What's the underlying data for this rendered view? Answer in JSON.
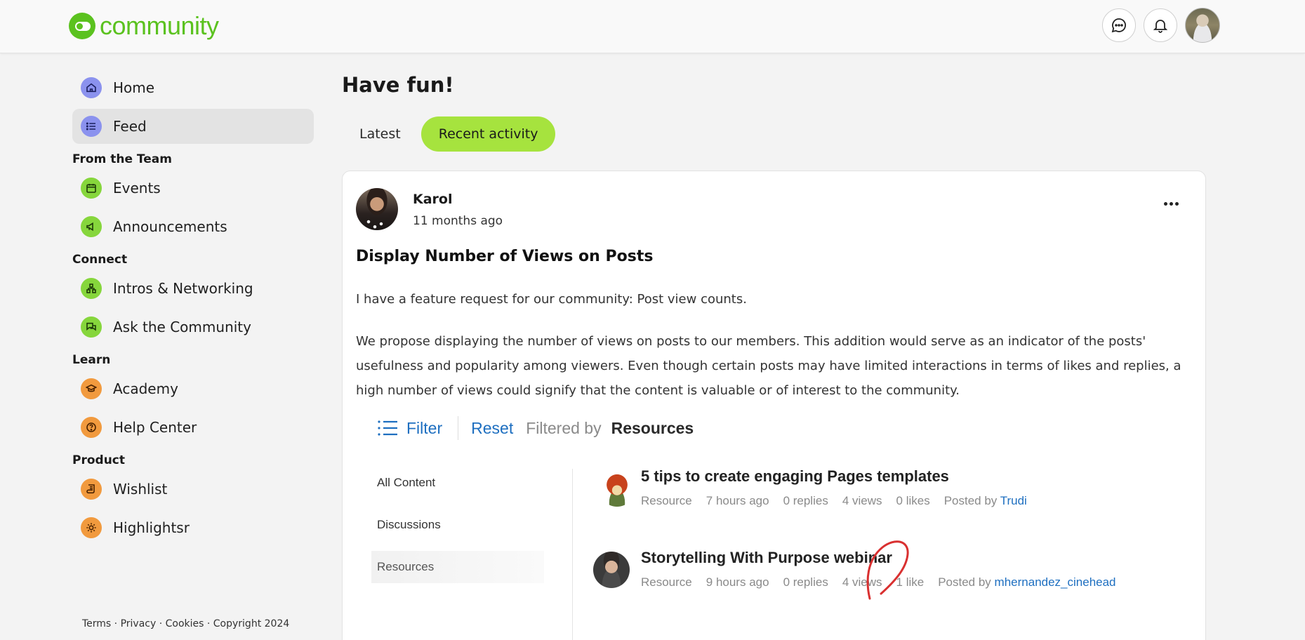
{
  "header": {
    "brand": "community",
    "icons": [
      "chat-bubble-icon",
      "bell-icon"
    ]
  },
  "sidebar": {
    "top_items": [
      {
        "label": "Home",
        "icon": "home-icon",
        "color": "#8b92ee"
      },
      {
        "label": "Feed",
        "icon": "list-icon",
        "color": "#8b92ee",
        "active": true
      }
    ],
    "sections": [
      {
        "title": "From the Team",
        "items": [
          {
            "label": "Events",
            "icon": "calendar-icon",
            "color": "#86d63c"
          },
          {
            "label": "Announcements",
            "icon": "megaphone-icon",
            "color": "#86d63c"
          }
        ]
      },
      {
        "title": "Connect",
        "items": [
          {
            "label": "Intros & Networking",
            "icon": "network-icon",
            "color": "#86d63c"
          },
          {
            "label": "Ask the Community",
            "icon": "chat-icon",
            "color": "#86d63c"
          }
        ]
      },
      {
        "title": "Learn",
        "items": [
          {
            "label": "Academy",
            "icon": "graduation-cap-icon",
            "color": "#f19a3e"
          },
          {
            "label": "Help Center",
            "icon": "question-icon",
            "color": "#f19a3e"
          }
        ]
      },
      {
        "title": "Product",
        "items": [
          {
            "label": "Wishlist",
            "icon": "scroll-icon",
            "color": "#f19a3e"
          },
          {
            "label": "Highlightsr",
            "icon": "sun-icon",
            "color": "#f19a3e"
          }
        ]
      }
    ],
    "footer": "Terms · Privacy · Cookies · Copyright 2024"
  },
  "main": {
    "title": "Have fun!",
    "tabs": [
      {
        "label": "Latest",
        "selected": false
      },
      {
        "label": "Recent activity",
        "selected": true
      }
    ]
  },
  "post": {
    "author": "Karol",
    "time": "11 months ago",
    "title": "Display Number of Views on Posts",
    "paragraph1": "I have a feature request for our community: Post view counts.",
    "paragraph2": "We propose displaying the number of views on posts to our members. This addition would serve as an indicator of the posts' usefulness and popularity among viewers. Even though certain posts may have limited interactions in terms of likes and replies, a high number of views could signify that the content is valuable or of interest to the community."
  },
  "embed": {
    "filter_label": "Filter",
    "reset_label": "Reset",
    "filtered_by_label": "Filtered by",
    "filtered_by_value": "Resources",
    "categories": [
      "All Content",
      "Discussions",
      "Resources"
    ],
    "selected_category": "Resources",
    "resources": [
      {
        "title": "5 tips to create engaging Pages templates",
        "type": "Resource",
        "time": "7 hours ago",
        "replies": "0 replies",
        "views": "4 views",
        "likes": "0 likes",
        "posted_by_label": "Posted by",
        "poster": "Trudi"
      },
      {
        "title": "Storytelling With Purpose webinar",
        "type": "Resource",
        "time": "9 hours ago",
        "replies": "0 replies",
        "views": "4 views",
        "likes": "1 like",
        "posted_by_label": "Posted by",
        "poster": "mhernandez_cinehead"
      }
    ],
    "accent_color": "#1e6fc0"
  },
  "colors": {
    "brand_green": "#5bc21f",
    "tab_selected": "#a6e33e",
    "nav_blue": "#8b92ee",
    "nav_green": "#86d63c",
    "nav_orange": "#f19a3e"
  }
}
